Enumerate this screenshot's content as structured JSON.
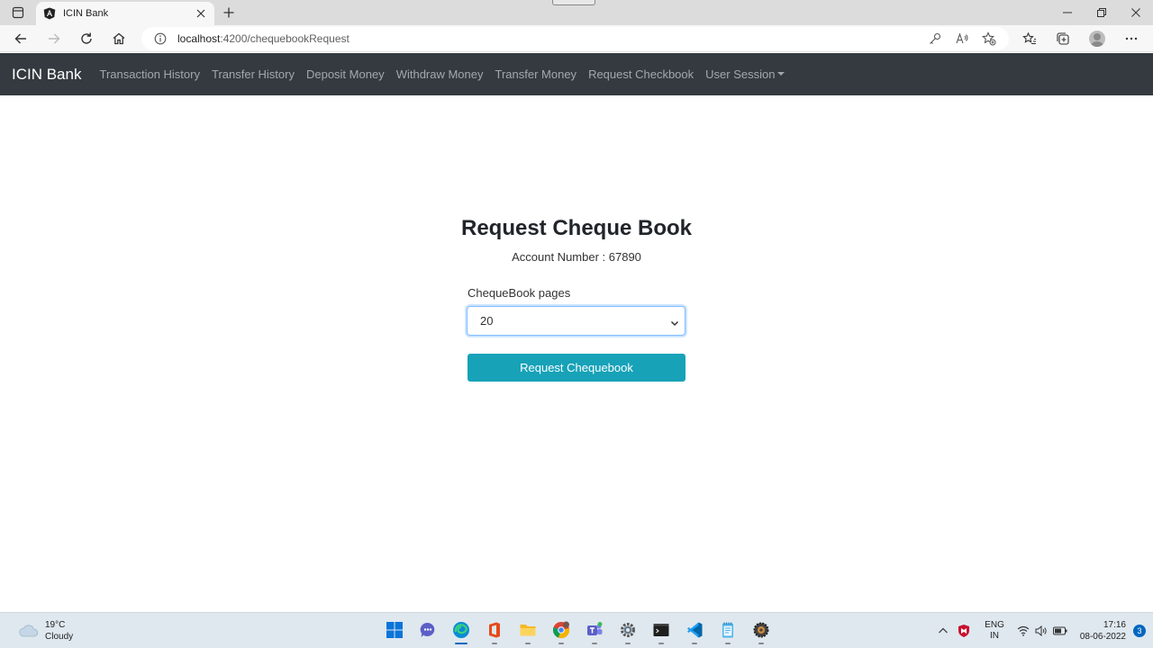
{
  "browser": {
    "tab_title": "ICIN Bank",
    "url_host": "localhost",
    "url_path": ":4200/chequebookRequest"
  },
  "navbar": {
    "brand": "ICIN Bank",
    "links": [
      "Transaction History",
      "Transfer History",
      "Deposit Money",
      "Withdraw Money",
      "Transfer Money",
      "Request Checkbook",
      "User Session"
    ]
  },
  "form": {
    "title": "Request Cheque Book",
    "account_line": "Account Number : 67890",
    "pages_label": "ChequeBook pages",
    "pages_selected": "20",
    "submit_label": "Request Chequebook"
  },
  "taskbar": {
    "weather_temp": "19°C",
    "weather_desc": "Cloudy",
    "lang_top": "ENG",
    "lang_bottom": "IN",
    "time": "17:16",
    "date": "08-06-2022",
    "notification_count": "3"
  },
  "colors": {
    "navbar_bg": "#343a40",
    "button_bg": "#17a2b8",
    "select_focus": "#80bdff"
  }
}
